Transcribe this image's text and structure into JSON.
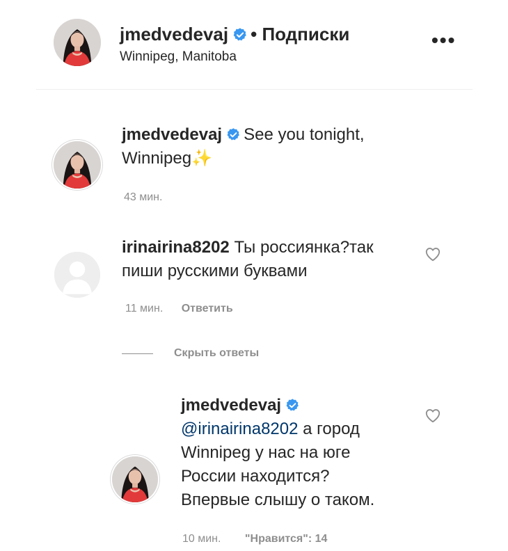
{
  "header": {
    "username": "jmedvedevaj",
    "separator": "•",
    "follow_label": "Подписки",
    "location": "Winnipeg, Manitoba",
    "more_icon": "more-horizontal-icon"
  },
  "post_caption": {
    "username": "jmedvedevaj",
    "text_line1": "See you tonight,",
    "text_line2": "Winnipeg",
    "emoji": "✨",
    "time": "43 мин."
  },
  "comments": [
    {
      "username": "irinairina8202",
      "text_line1": "Ты россиянка?так",
      "text_line2": "пиши русскими буквами",
      "time": "11 мин.",
      "reply_label": "Ответить"
    }
  ],
  "hide_replies_label": "Скрыть ответы",
  "reply": {
    "username": "jmedvedevaj",
    "mention": "@irinairina8202",
    "line1_rest": " а город",
    "line2": "Winnipeg у нас на юге",
    "line3": "России находится?",
    "line4": "Впервые слышу о таком.",
    "time": "10 мин.",
    "likes_label": "\"Нравится\": 14"
  },
  "colors": {
    "verified": "#3897f0",
    "text": "#262626",
    "muted": "#8e8e8e",
    "mention": "#00376b"
  }
}
